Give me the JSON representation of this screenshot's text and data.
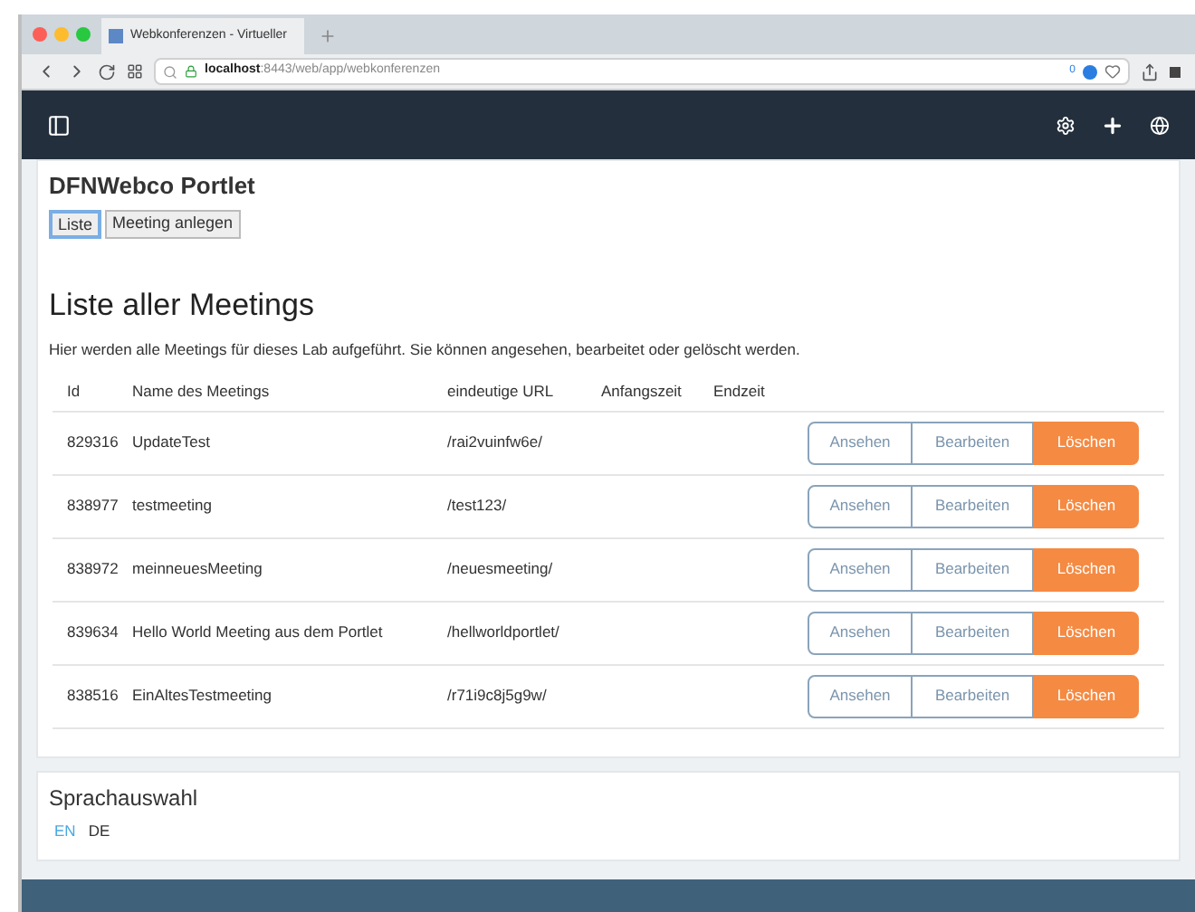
{
  "browser": {
    "tab_title": "Webkonferenzen - Virtueller",
    "address_host": "localhost",
    "address_path": ":8443/web/app/webkonferenzen",
    "badge_count": "0"
  },
  "portlet": {
    "title": "DFNWebco Portlet",
    "tabs": [
      {
        "label": "Liste",
        "selected": true
      },
      {
        "label": "Meeting anlegen",
        "selected": false
      }
    ],
    "heading": "Liste aller Meetings",
    "description": "Hier werden alle Meetings für dieses Lab aufgeführt. Sie können angesehen, bearbeitet oder gelöscht werden.",
    "table": {
      "columns": [
        "Id",
        "Name des Meetings",
        "eindeutige URL",
        "Anfangszeit",
        "Endzeit"
      ],
      "rows": [
        {
          "id": "829316",
          "name": "UpdateTest",
          "url": "/rai2vuinfw6e/",
          "actions": [
            "Ansehen",
            "Bearbeiten",
            "Löschen"
          ]
        },
        {
          "id": "838977",
          "name": "testmeeting",
          "url": "/test123/",
          "actions": [
            "Ansehen",
            "Bearbeiten",
            "Löschen"
          ]
        },
        {
          "id": "838972",
          "name": "meinneuesMeeting",
          "url": "/neuesmeeting/",
          "actions": [
            "Ansehen",
            "Bearbeiten",
            "Löschen"
          ]
        },
        {
          "id": "839634",
          "name": "Hello World Meeting aus dem Portlet",
          "url": "/hellworldportlet/",
          "actions": [
            "Ansehen",
            "Bearbeiten",
            "Löschen"
          ]
        },
        {
          "id": "838516",
          "name": "EinAltesTestmeeting",
          "url": "/r71i9c8j5g9w/",
          "actions": [
            "Ansehen",
            "Bearbeiten",
            "Löschen"
          ]
        }
      ]
    }
  },
  "language": {
    "title": "Sprachauswahl",
    "options": [
      {
        "label": "EN",
        "selected": true
      },
      {
        "label": "DE",
        "selected": false
      }
    ]
  }
}
